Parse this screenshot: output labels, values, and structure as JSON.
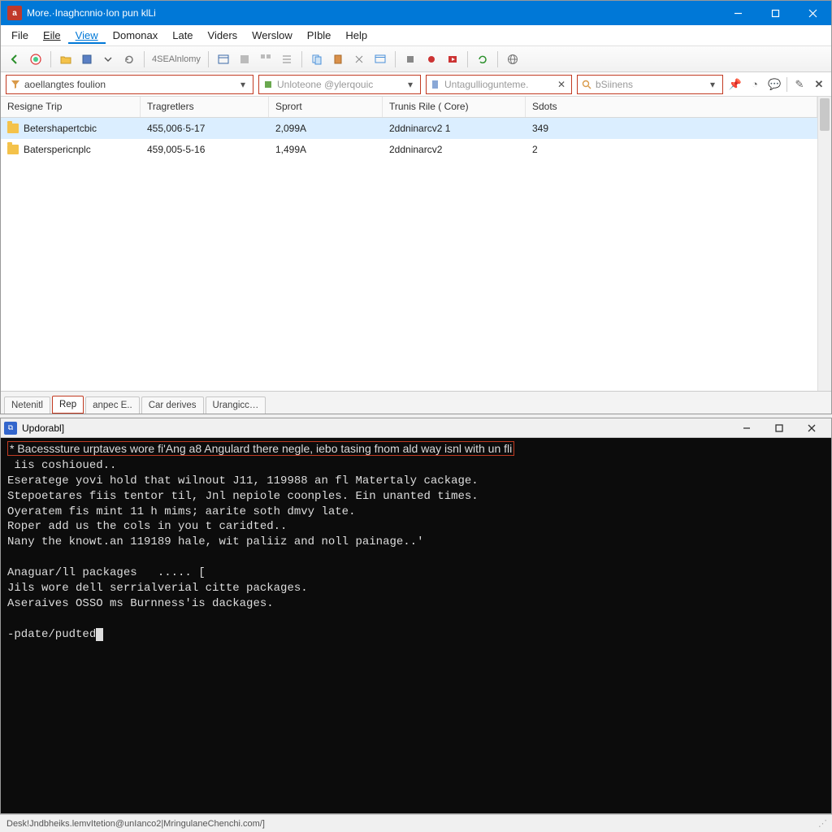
{
  "topWindow": {
    "title": "More.·Inaghcnnio·Ion pun klLi",
    "menu": [
      "File",
      "Eile",
      "View",
      "Domonax",
      "Late",
      "Viders",
      "Werslow",
      "PIble",
      "Help"
    ],
    "toolbarLabel": "4SEAlnlomy",
    "filters": {
      "combo1": "aoellangtes foulion",
      "combo2": "Unloteone @ylerqouic",
      "combo3_placeholder": "Untagulliogunteme.",
      "combo4_placeholder": "bSiinens"
    },
    "table": {
      "headers": [
        "Resigne Trip",
        "Tragretlers",
        "Sprort",
        "Trunis Rile ( Core)",
        "Sdots"
      ],
      "rows": [
        {
          "name": "Betershapertcbic",
          "c2": "455,006·5-17",
          "c3": "2,099A",
          "c4": "2ddninarcv2 1",
          "c5": "349"
        },
        {
          "name": "Baterspericnplc",
          "c2": "459,005-5-16",
          "c3": "1,499A",
          "c4": "2ddninarcv2",
          "c5": "2"
        }
      ]
    },
    "tabs": [
      "Netenitl",
      "Rep",
      "anpec E..",
      "Car derives",
      "Urangicc…"
    ]
  },
  "terminalWindow": {
    "title": "Updorabl]",
    "lines": [
      "* Bacesssture urptaves wore fi'Ang a8 Angulard there negle, iebo tasing fnom ald way isnl with un fli",
      " iis coshioued..",
      "Eseratege yovi hold that wilnout J11, 119988 an fl Matertaly cackage.",
      "Stepoetares fiis tentor til, Jnl nepiole coonples. Ein unanted times.",
      "Oyeratem fis mint 11 h mims; aarite soth dmvy late.",
      "Roper add us the cols in you t caridted..",
      "Nany the knowt.an 119189 hale, wit paliiz and noll painage..'",
      "",
      "Anaguar/ll packages   ..... [",
      "Jils wore dell serrialverial citte packages.",
      "Aseraives OSSO ms Burnness'is dackages.",
      "",
      "-pdate/pudted"
    ]
  },
  "statusbar": "Desk!Jndbheiks.lemvItetion@unIanco2|MringulaneChenchi.com/]"
}
